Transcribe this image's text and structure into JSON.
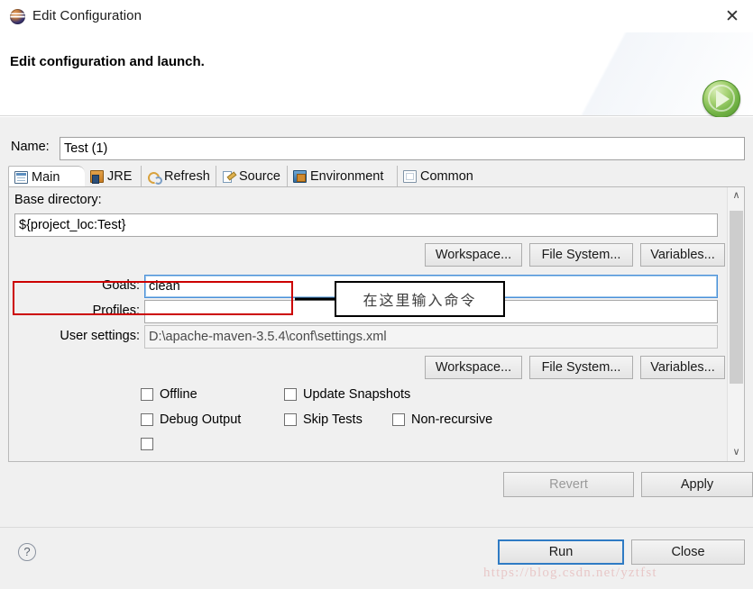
{
  "window": {
    "title": "Edit Configuration",
    "icon": "eclipse-logo-icon",
    "close_label": "✕"
  },
  "header": {
    "title": "Edit configuration and launch.",
    "badge_icon": "green-run-play-icon"
  },
  "name_row": {
    "label": "Name:",
    "value": "Test (1)"
  },
  "tabs": [
    {
      "label": "Main",
      "icon": "main-page-icon",
      "active": true
    },
    {
      "label": "JRE",
      "icon": "jre-books-icon",
      "active": false
    },
    {
      "label": "Refresh",
      "icon": "refresh-arrows-icon",
      "active": false
    },
    {
      "label": "Source",
      "icon": "source-pencil-icon",
      "active": false
    },
    {
      "label": "Environment",
      "icon": "environment-icon",
      "active": false
    },
    {
      "label": "Common",
      "icon": "common-window-icon",
      "active": false
    }
  ],
  "main_tab": {
    "base_directory": {
      "label": "Base directory:",
      "value": "${project_loc:Test}"
    },
    "dir_buttons": [
      {
        "label": "Workspace...",
        "name": "base-workspace-button"
      },
      {
        "label": "File System...",
        "name": "base-file-system-button"
      },
      {
        "label": "Variables...",
        "name": "base-variables-button"
      }
    ],
    "goals": {
      "label": "Goals:",
      "value": "clean",
      "focused": true
    },
    "profiles": {
      "label": "Profiles:",
      "value": ""
    },
    "user_settings": {
      "label": "User settings:",
      "value": "D:\\apache-maven-3.5.4\\conf\\settings.xml"
    },
    "settings_buttons": [
      {
        "label": "Workspace...",
        "name": "settings-workspace-button"
      },
      {
        "label": "File System...",
        "name": "settings-file-system-button"
      },
      {
        "label": "Variables...",
        "name": "settings-variables-button"
      }
    ],
    "checkboxes": [
      {
        "label": "Offline",
        "checked": false,
        "name": "checkbox-offline"
      },
      {
        "label": "Update Snapshots",
        "checked": false,
        "name": "checkbox-update-snapshots"
      },
      {
        "label": "Debug Output",
        "checked": false,
        "name": "checkbox-debug-output"
      },
      {
        "label": "Skip Tests",
        "checked": false,
        "name": "checkbox-skip-tests"
      },
      {
        "label": "Non-recursive",
        "checked": false,
        "name": "checkbox-non-recursive"
      }
    ],
    "scrollbar": {
      "up_glyph": "∧",
      "down_glyph": "∨"
    }
  },
  "apply_bar": {
    "revert_label": "Revert",
    "apply_label": "Apply"
  },
  "footer": {
    "help_glyph": "?",
    "run_label": "Run",
    "close_label": "Close"
  },
  "annotation": {
    "text": "在这里输入命令",
    "highlight_color": "#cc0000"
  },
  "watermark": {
    "text": "https://blog.csdn.net/yztfst"
  }
}
